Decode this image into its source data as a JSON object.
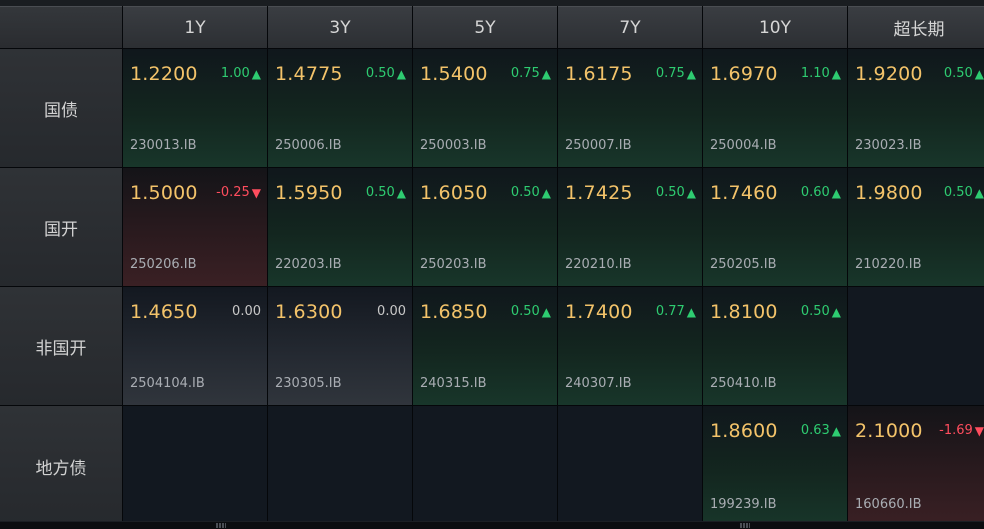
{
  "tenors": [
    "1Y",
    "3Y",
    "5Y",
    "7Y",
    "10Y",
    "超长期"
  ],
  "rows": [
    {
      "label": "国债",
      "cells": [
        {
          "rate": "1.2200",
          "change": "1.00",
          "dir": "up",
          "arrow": "▲",
          "code": "230013.IB"
        },
        {
          "rate": "1.4775",
          "change": "0.50",
          "dir": "up",
          "arrow": "▲",
          "code": "250006.IB"
        },
        {
          "rate": "1.5400",
          "change": "0.75",
          "dir": "up",
          "arrow": "▲",
          "code": "250003.IB"
        },
        {
          "rate": "1.6175",
          "change": "0.75",
          "dir": "up",
          "arrow": "▲",
          "code": "250007.IB"
        },
        {
          "rate": "1.6970",
          "change": "1.10",
          "dir": "up",
          "arrow": "▲",
          "code": "250004.IB"
        },
        {
          "rate": "1.9200",
          "change": "0.50",
          "dir": "up",
          "arrow": "▲",
          "code": "230023.IB"
        }
      ]
    },
    {
      "label": "国开",
      "cells": [
        {
          "rate": "1.5000",
          "change": "-0.25",
          "dir": "down",
          "arrow": "▼",
          "code": "250206.IB"
        },
        {
          "rate": "1.5950",
          "change": "0.50",
          "dir": "up",
          "arrow": "▲",
          "code": "220203.IB"
        },
        {
          "rate": "1.6050",
          "change": "0.50",
          "dir": "up",
          "arrow": "▲",
          "code": "250203.IB"
        },
        {
          "rate": "1.7425",
          "change": "0.50",
          "dir": "up",
          "arrow": "▲",
          "code": "220210.IB"
        },
        {
          "rate": "1.7460",
          "change": "0.60",
          "dir": "up",
          "arrow": "▲",
          "code": "250205.IB"
        },
        {
          "rate": "1.9800",
          "change": "0.50",
          "dir": "up",
          "arrow": "▲",
          "code": "210220.IB"
        }
      ]
    },
    {
      "label": "非国开",
      "cells": [
        {
          "rate": "1.4650",
          "change": "0.00",
          "dir": "flat",
          "arrow": "",
          "code": "2504104.IB"
        },
        {
          "rate": "1.6300",
          "change": "0.00",
          "dir": "flat",
          "arrow": "",
          "code": "230305.IB"
        },
        {
          "rate": "1.6850",
          "change": "0.50",
          "dir": "up",
          "arrow": "▲",
          "code": "240315.IB"
        },
        {
          "rate": "1.7400",
          "change": "0.77",
          "dir": "up",
          "arrow": "▲",
          "code": "240307.IB"
        },
        {
          "rate": "1.8100",
          "change": "0.50",
          "dir": "up",
          "arrow": "▲",
          "code": "250410.IB"
        },
        null
      ]
    },
    {
      "label": "地方债",
      "cells": [
        null,
        null,
        null,
        null,
        {
          "rate": "1.8600",
          "change": "0.63",
          "dir": "up",
          "arrow": "▲",
          "code": "199239.IB"
        },
        {
          "rate": "2.1000",
          "change": "-1.69",
          "dir": "down",
          "arrow": "▼",
          "code": "160660.IB"
        }
      ]
    }
  ],
  "colors": {
    "rate": "#f3c36a",
    "up": "#2ecc71",
    "down": "#ff4d5e",
    "flat": "#c8c8c8"
  }
}
